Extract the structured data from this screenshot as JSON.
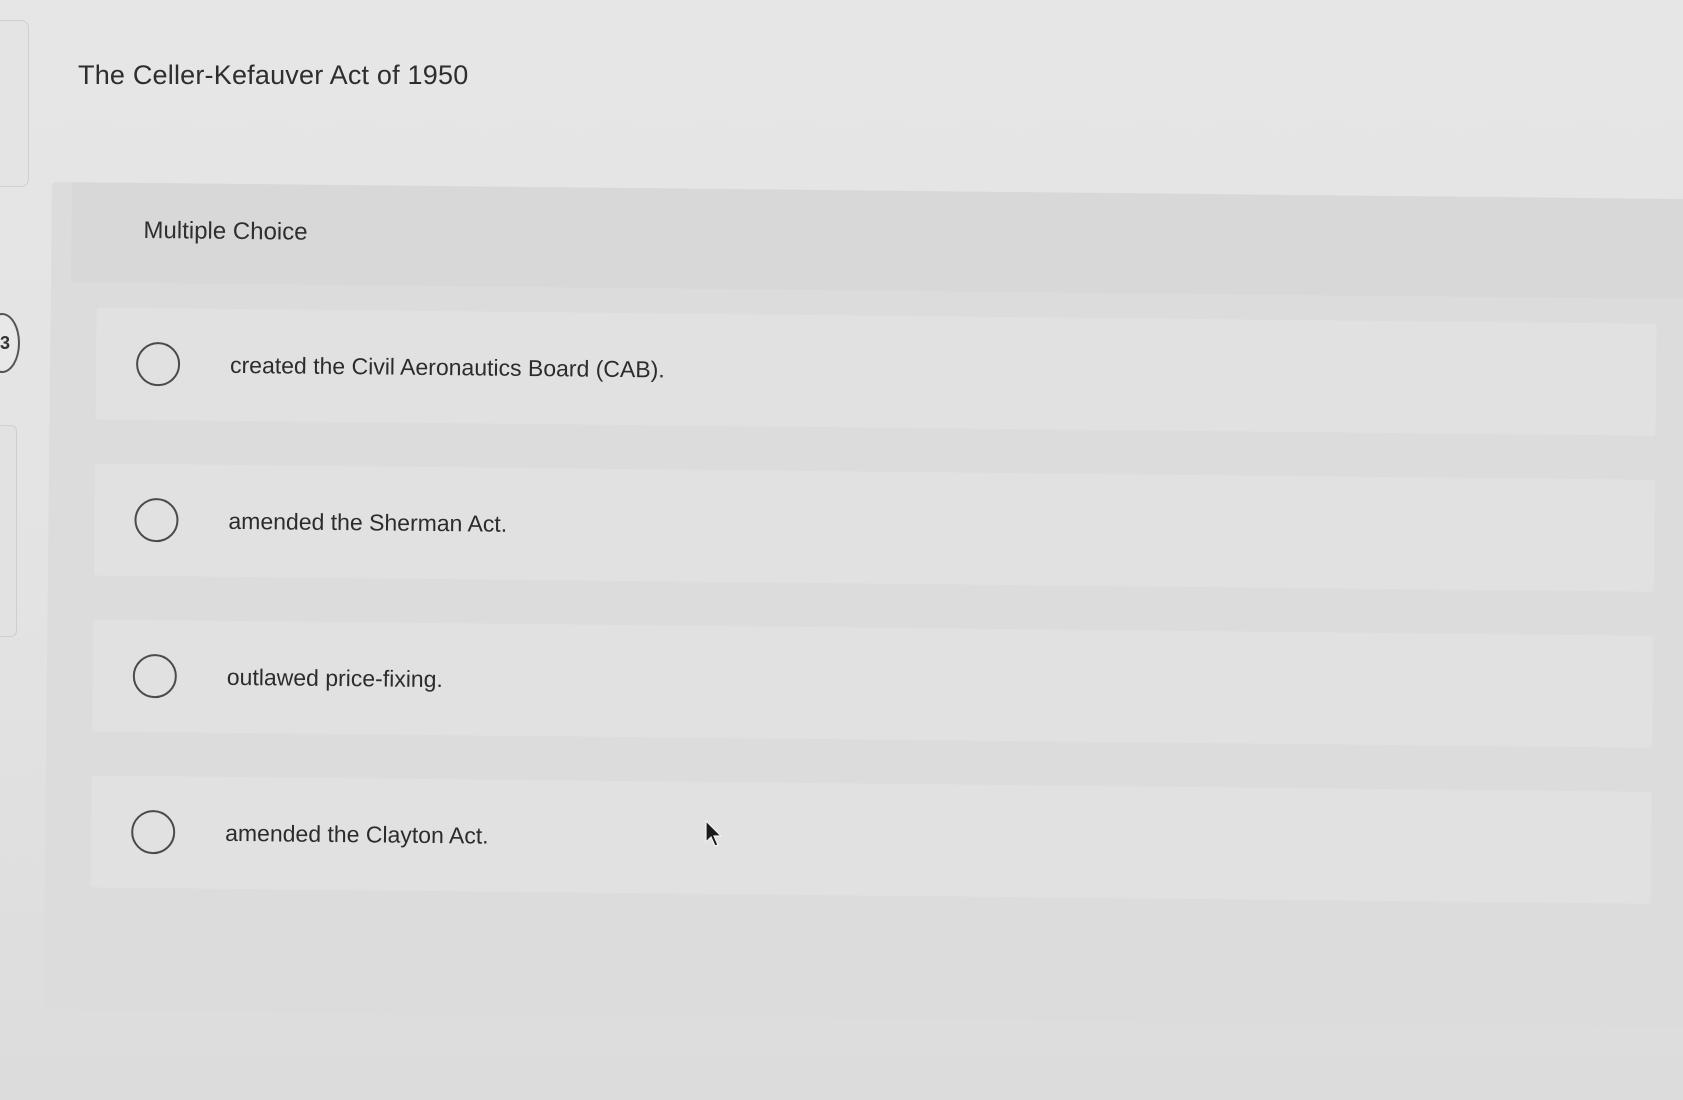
{
  "question": {
    "number": "3",
    "title": "The Celler-Kefauver Act of 1950"
  },
  "choice_panel": {
    "label": "Multiple Choice",
    "options": [
      {
        "text": "created the Civil Aeronautics Board (CAB).",
        "selected": false
      },
      {
        "text": "amended the Sherman Act.",
        "selected": false
      },
      {
        "text": "outlawed price-fixing.",
        "selected": false
      },
      {
        "text": "amended the Clayton Act.",
        "selected": false
      }
    ]
  },
  "icons": {
    "radio": "radio-button-icon",
    "cursor": "mouse-pointer-icon"
  }
}
